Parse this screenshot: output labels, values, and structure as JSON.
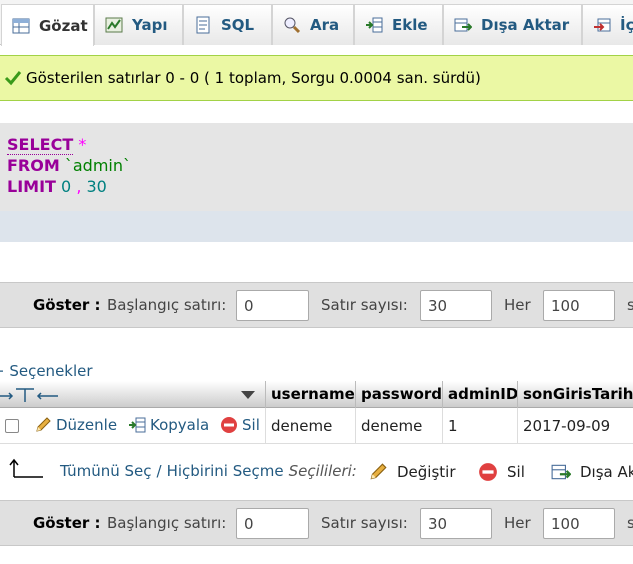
{
  "tabs": [
    {
      "label": "Gözat",
      "icon": "table-browse-icon",
      "active": true
    },
    {
      "label": "Yapı",
      "icon": "structure-icon"
    },
    {
      "label": "SQL",
      "icon": "sql-icon"
    },
    {
      "label": "Ara",
      "icon": "search-icon"
    },
    {
      "label": "Ekle",
      "icon": "insert-icon"
    },
    {
      "label": "Dışa Aktar",
      "icon": "export-icon"
    },
    {
      "label": "İç",
      "icon": "import-icon"
    }
  ],
  "success_message": "Gösterilen satırlar 0 - 0 ( 1 toplam, Sorgu 0.0004 san. sürdü)",
  "sql": {
    "select_kw": "SELECT",
    "star": "*",
    "from_kw": "FROM",
    "table": "`admin`",
    "limit_kw": "LIMIT",
    "offset": "0",
    "comma": ",",
    "count": "30"
  },
  "nav": {
    "show_label": "Göster :",
    "start_label": "Başlangıç satırı:",
    "start_value": "0",
    "rows_label": "Satır sayısı:",
    "rows_value": "30",
    "every_label": "Her",
    "every_value": "100",
    "trailing": "s"
  },
  "options_label": "+ Seçenekler",
  "table": {
    "columns": [
      "username",
      "password",
      "adminID",
      "sonGirisTarihi"
    ],
    "rows": [
      {
        "username": "deneme",
        "password": "deneme",
        "adminID": "1",
        "sonGirisTarihi": "2017-09-09"
      }
    ],
    "actions": {
      "edit": "Düzenle",
      "copy": "Kopyala",
      "delete": "Sil"
    }
  },
  "bulk": {
    "select_all": "Tümünü Seç",
    "separator": "/",
    "select_none": "Hiçbirini Seçme",
    "selected_label": "Seçilileri:",
    "change": "Değiştir",
    "delete": "Sil",
    "export": "Dışa Ak"
  },
  "colors": {
    "link": "#235a81",
    "success_bg": "#ebf8a4",
    "sql_keyword": "#990099"
  }
}
